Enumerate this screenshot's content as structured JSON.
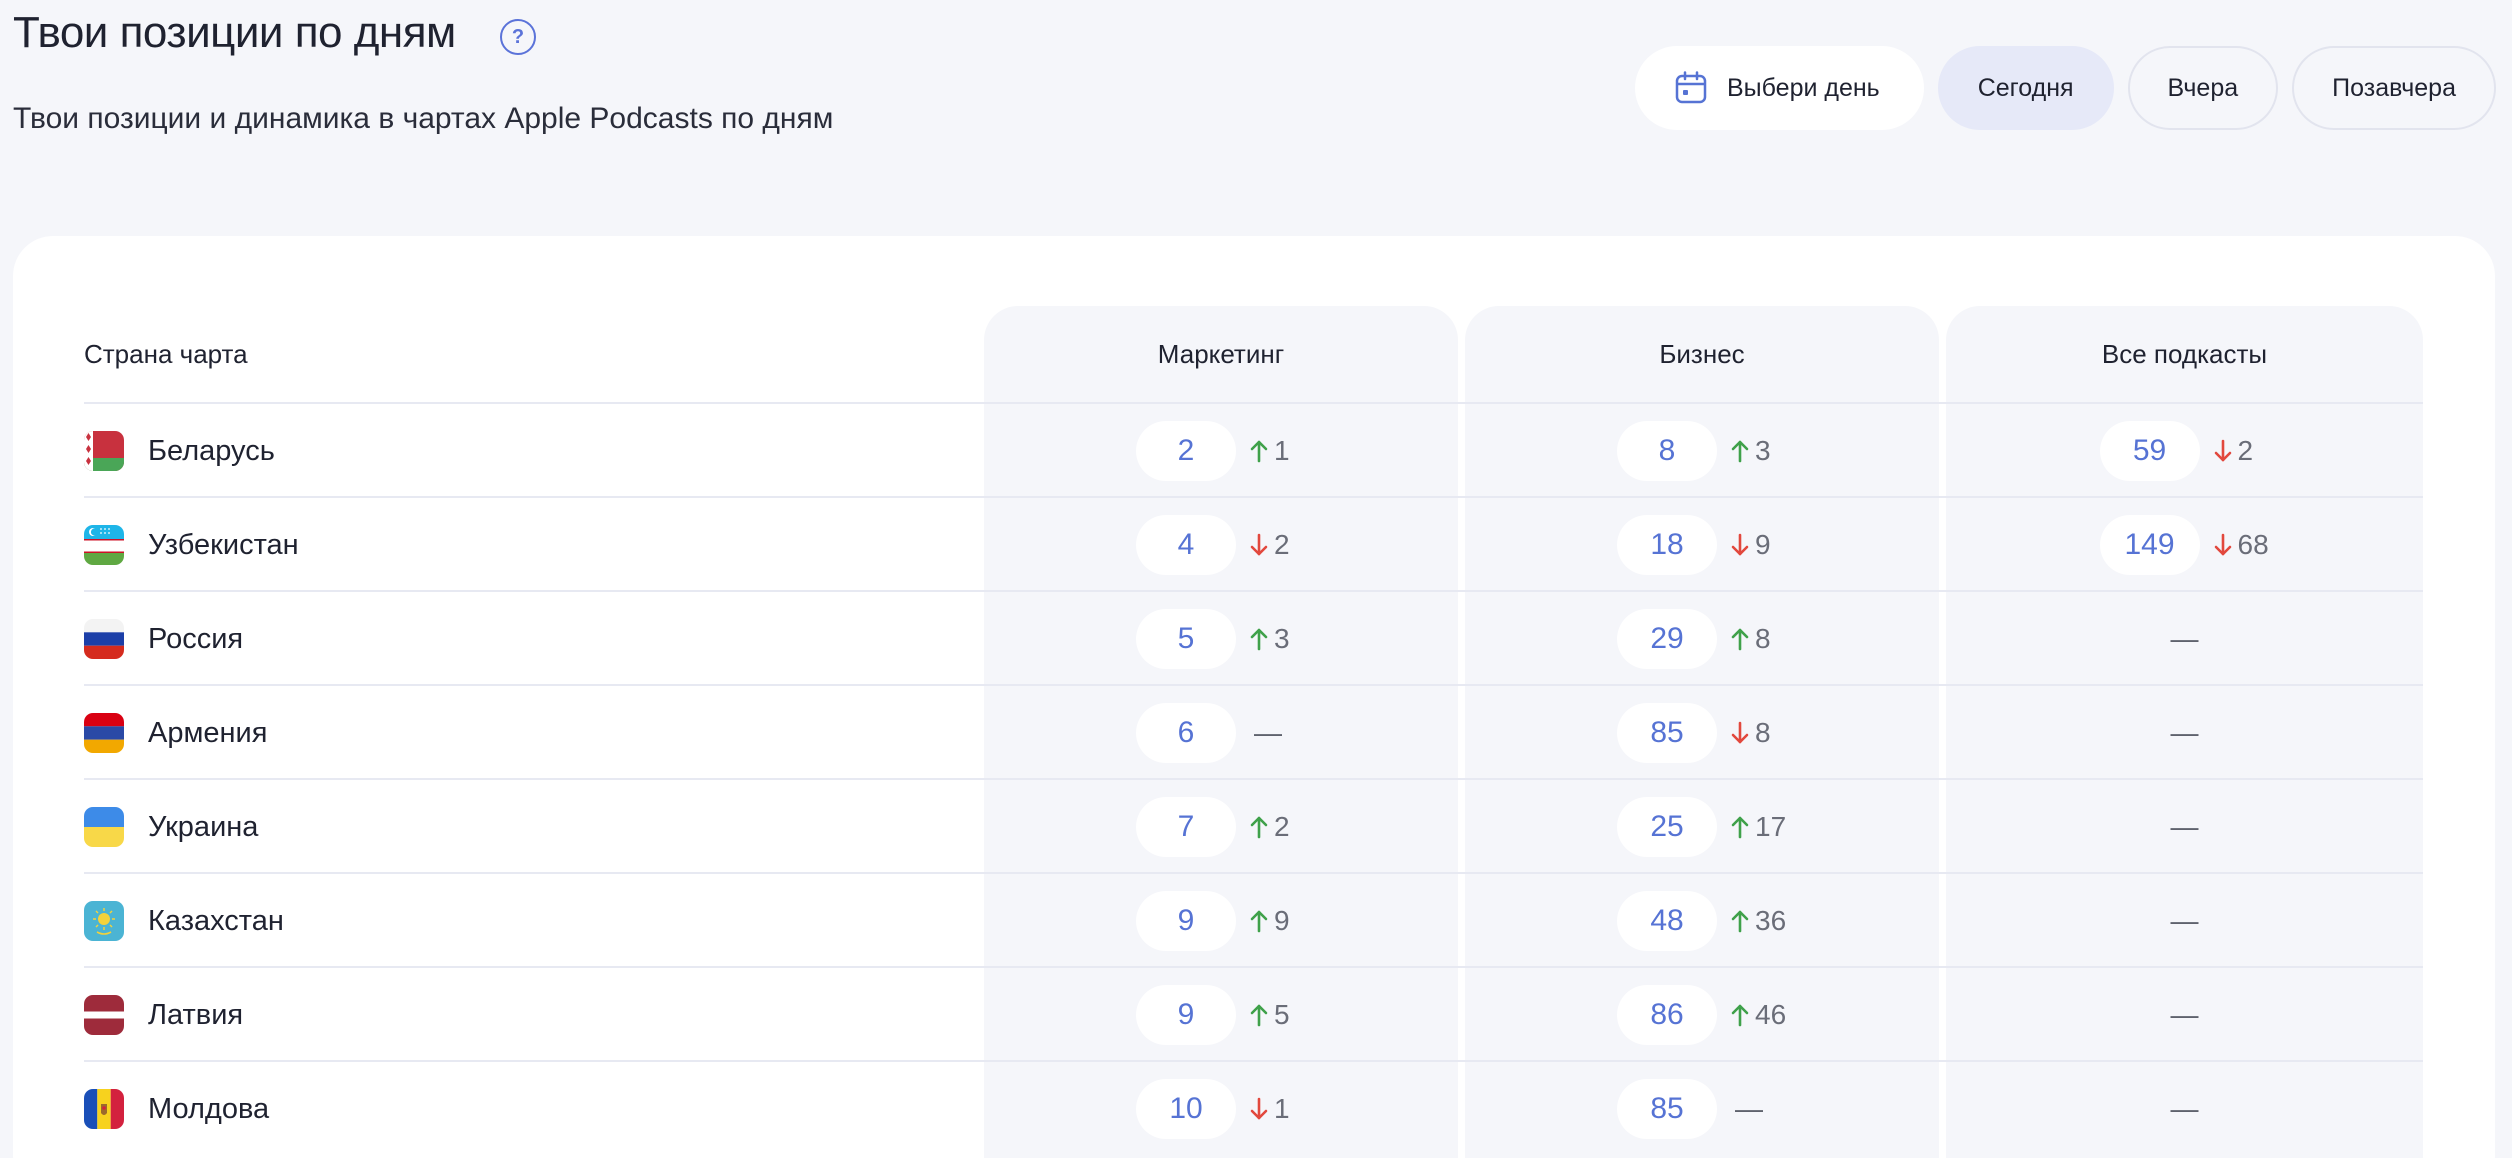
{
  "header": {
    "title": "Твои позиции по дням",
    "help": "?",
    "subtitle": "Твои позиции и динамика в чартах Apple Podcasts по дням"
  },
  "day_buttons": {
    "pick_label": "Выбери день",
    "today_label": "Сегодня",
    "yesterday_label": "Вчера",
    "day_before_label": "Позавчера",
    "active": "today"
  },
  "table": {
    "columns": {
      "country": "Страна чарта",
      "marketing": "Маркетинг",
      "business": "Бизнес",
      "all": "Все подкасты"
    },
    "rows": [
      {
        "country": "Беларусь",
        "flag": "by",
        "marketing": {
          "pos": "2",
          "dir": "up",
          "delta": "1"
        },
        "business": {
          "pos": "8",
          "dir": "up",
          "delta": "3"
        },
        "all": {
          "pos": "59",
          "dir": "down",
          "delta": "2"
        }
      },
      {
        "country": "Узбекистан",
        "flag": "uz",
        "marketing": {
          "pos": "4",
          "dir": "down",
          "delta": "2"
        },
        "business": {
          "pos": "18",
          "dir": "down",
          "delta": "9"
        },
        "all": {
          "pos": "149",
          "dir": "down",
          "delta": "68"
        }
      },
      {
        "country": "Россия",
        "flag": "ru",
        "marketing": {
          "pos": "5",
          "dir": "up",
          "delta": "3"
        },
        "business": {
          "pos": "29",
          "dir": "up",
          "delta": "8"
        },
        "all": null
      },
      {
        "country": "Армения",
        "flag": "am",
        "marketing": {
          "pos": "6",
          "dir": "none",
          "delta": "—"
        },
        "business": {
          "pos": "85",
          "dir": "down",
          "delta": "8"
        },
        "all": null
      },
      {
        "country": "Украина",
        "flag": "ua",
        "marketing": {
          "pos": "7",
          "dir": "up",
          "delta": "2"
        },
        "business": {
          "pos": "25",
          "dir": "up",
          "delta": "17"
        },
        "all": null
      },
      {
        "country": "Казахстан",
        "flag": "kz",
        "marketing": {
          "pos": "9",
          "dir": "up",
          "delta": "9"
        },
        "business": {
          "pos": "48",
          "dir": "up",
          "delta": "36"
        },
        "all": null
      },
      {
        "country": "Латвия",
        "flag": "lv",
        "marketing": {
          "pos": "9",
          "dir": "up",
          "delta": "5"
        },
        "business": {
          "pos": "86",
          "dir": "up",
          "delta": "46"
        },
        "all": null
      },
      {
        "country": "Молдова",
        "flag": "md",
        "marketing": {
          "pos": "10",
          "dir": "down",
          "delta": "1"
        },
        "business": {
          "pos": "85",
          "dir": "none",
          "delta": "—"
        },
        "all": null
      }
    ],
    "empty_value": "—"
  },
  "colors": {
    "up": "#3fa14a",
    "down": "#e2483d",
    "accent": "#5673d4",
    "active_button": "#e6e9f8"
  }
}
